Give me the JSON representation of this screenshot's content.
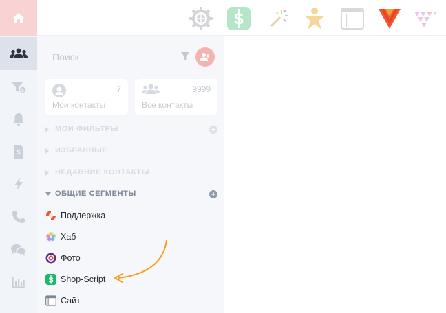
{
  "colors": {
    "accent": "#f6a01a",
    "rail_bg": "#f1f4f9",
    "home_bg": "#f9d3d3",
    "sidebar_bg": "#f5f7fa",
    "add_contact": "#f5b3ae"
  },
  "rail": {
    "items": [
      {
        "icon": "home-icon"
      },
      {
        "icon": "users-icon",
        "active": true
      },
      {
        "icon": "funnel-dollar-icon"
      },
      {
        "icon": "bell-icon"
      },
      {
        "icon": "invoice-icon"
      },
      {
        "icon": "lightning-icon"
      },
      {
        "icon": "phone-icon"
      },
      {
        "icon": "chat-icon"
      },
      {
        "icon": "chart-icon"
      }
    ]
  },
  "topbar": {
    "apps": [
      {
        "icon": "gear-app-icon"
      },
      {
        "icon": "shop-script-app-icon"
      },
      {
        "icon": "magic-wand-app-icon"
      },
      {
        "icon": "star-person-app-icon"
      },
      {
        "icon": "site-app-icon"
      },
      {
        "icon": "v-logo-app-icon"
      },
      {
        "icon": "triangle-logo-app-icon"
      }
    ]
  },
  "search": {
    "placeholder": "Поиск"
  },
  "cards": {
    "my": {
      "count": "7",
      "label": "Мои контакты"
    },
    "all": {
      "count": "9999",
      "label": "Все контакты"
    }
  },
  "sections": {
    "filters": "МОИ ФИЛЬТРЫ",
    "favorites": "ИЗБРАННЫЕ",
    "recent": "НЕДАВНИЕ КОНТАКТЫ",
    "segments": "ОБЩИЕ СЕГМЕНТЫ"
  },
  "segments": [
    {
      "label": "Поддержка",
      "icon": "lifebuoy-icon"
    },
    {
      "label": "Хаб",
      "icon": "hub-icon"
    },
    {
      "label": "Фото",
      "icon": "photo-icon"
    },
    {
      "label": "Shop-Script",
      "icon": "shop-script-icon"
    },
    {
      "label": "Сайт",
      "icon": "site-icon"
    }
  ]
}
